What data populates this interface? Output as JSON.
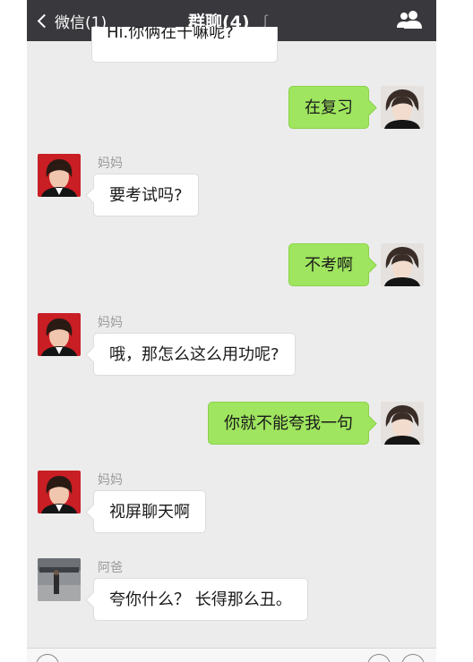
{
  "topbar": {
    "back_label": "微信(1)",
    "title": "群聊(4)",
    "ear_icon": "ear-icon",
    "group_icon": "group-members-icon"
  },
  "clipped_message": {
    "text": "Hi.你俩在干嘛呢?"
  },
  "messages": [
    {
      "side": "right",
      "sender": "",
      "text": "在复习"
    },
    {
      "side": "left",
      "sender": "妈妈",
      "text": "要考试吗?"
    },
    {
      "side": "right",
      "sender": "",
      "text": "不考啊"
    },
    {
      "side": "left",
      "sender": "妈妈",
      "text": "哦，那怎么这么用功呢?"
    },
    {
      "side": "right",
      "sender": "",
      "text": "你就不能夸我一句"
    },
    {
      "side": "left",
      "sender": "妈妈",
      "text": "视屏聊天啊"
    },
    {
      "side": "left",
      "sender": "阿爸",
      "text": "夸你什么？ 长得那么丑。"
    }
  ],
  "input": {
    "voice_icon": "voice-icon",
    "emoji_icon": "emoji-icon",
    "plus_icon": "plus-icon"
  },
  "colors": {
    "topbar": "#38383d",
    "chat_bg": "#ececec",
    "green_bubble": "#9fe55f",
    "white_bubble": "#ffffff"
  }
}
